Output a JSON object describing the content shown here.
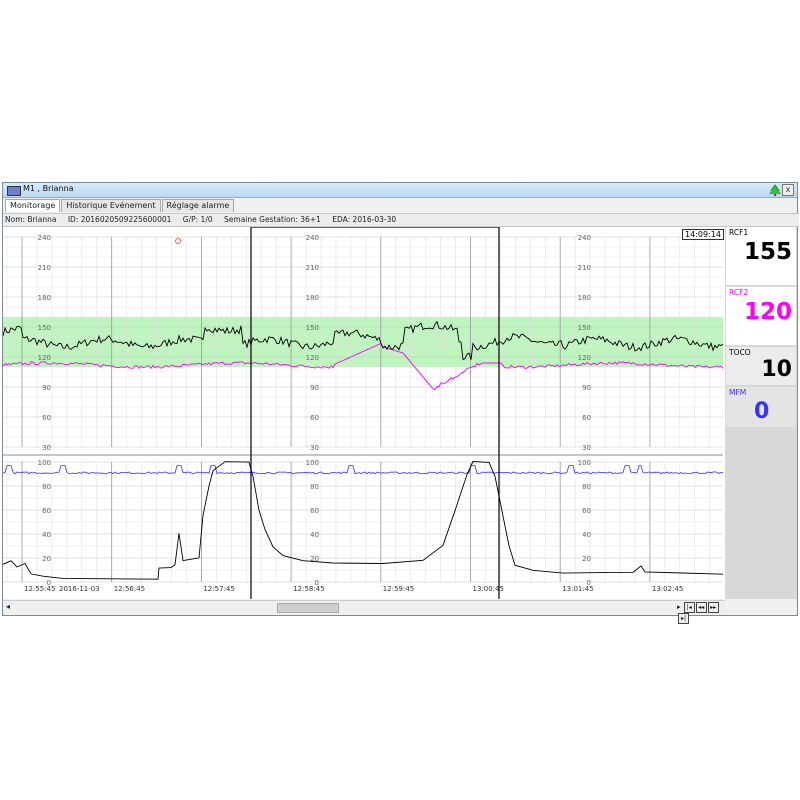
{
  "window": {
    "title": "M1 , Brianna",
    "close_label": "x"
  },
  "tabs": [
    {
      "label": "Monitorage"
    },
    {
      "label": "Historique Evénement"
    },
    {
      "label": "Réglage alarme"
    }
  ],
  "patient": {
    "name": "Nom: Brianna",
    "id": "ID: 2016020509225600001",
    "gp": "G/P: 1/0",
    "gestation": "Semaine Gestation: 36+1",
    "eda": "EDA: 2016-03-30"
  },
  "clock": "14:09:14",
  "panels": {
    "rcf1": {
      "label": "RCF1",
      "value": "155",
      "color": "#000000"
    },
    "rcf2": {
      "label": "RCF2",
      "value": "120",
      "color": "#ff00ff"
    },
    "toco": {
      "label": "TOCO",
      "value": "10",
      "color": "#000000"
    },
    "mfm": {
      "label": "MFM",
      "value": "0",
      "color": "#3333ff"
    }
  },
  "chart_data": {
    "type": "line",
    "fhr_axis": {
      "ticks": [
        "240",
        "210",
        "180",
        "150",
        "120",
        "90",
        "60",
        "30"
      ],
      "ylim": [
        30,
        240
      ],
      "normal_band": [
        110,
        160
      ]
    },
    "toco_axis": {
      "ticks": [
        "100",
        "80",
        "60",
        "40",
        "20",
        "0"
      ],
      "ylim": [
        0,
        100
      ]
    },
    "time_labels": [
      "12:55:45",
      "12:56:45",
      "12:57:45",
      "12:58:45",
      "12:59:45",
      "13:00:45",
      "13:01:45",
      "13:02:45"
    ],
    "date_label": "2016-11-03",
    "series": [
      {
        "name": "RCF1",
        "color": "#000000"
      },
      {
        "name": "RCF2",
        "color": "#ff00ff"
      },
      {
        "name": "MFM",
        "color": "#3333ff"
      },
      {
        "name": "TOCO",
        "color": "#000000"
      }
    ]
  },
  "icons": {
    "window_icon": "monitor-icon",
    "alarm_icon": "tree-icon",
    "scroll_left": "◂",
    "nav": [
      "▸",
      "|◂",
      "◂◂",
      "▸▸",
      "▸|"
    ]
  }
}
